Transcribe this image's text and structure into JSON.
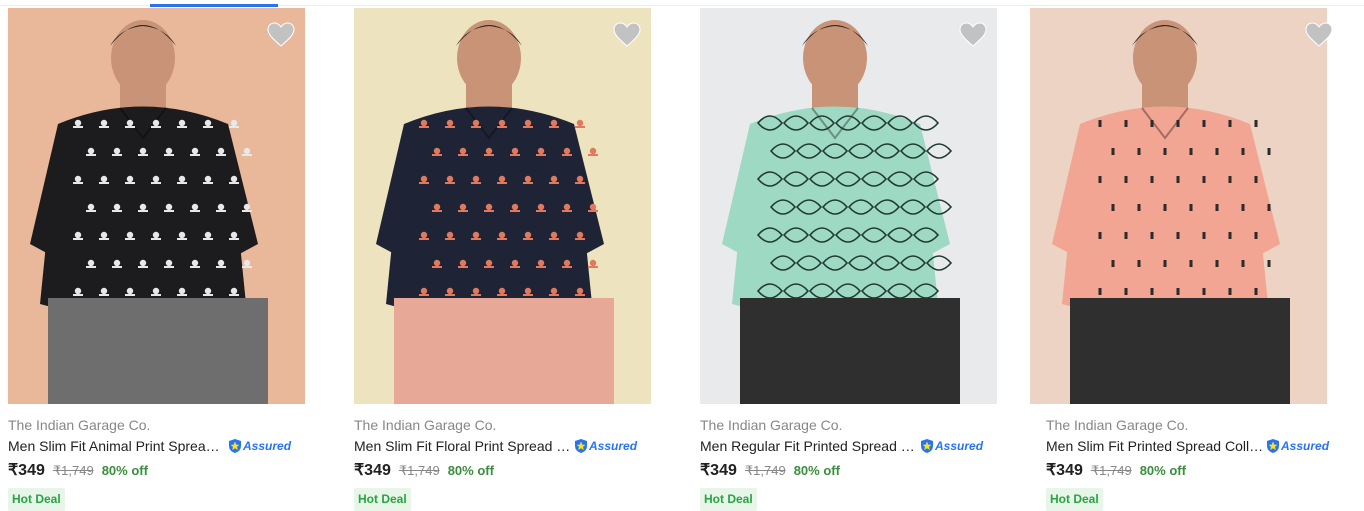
{
  "products": [
    {
      "brand": "The Indian Garage Co.",
      "title": "Men Slim Fit Animal Print Spread Collar Casual Shirt",
      "assured_label": "Assured",
      "price": "₹349",
      "mrp": "₹1,749",
      "discount": "80% off",
      "badge": "Hot Deal",
      "bg_color": "#e9b89a",
      "shirt_color": "#1c1c1f",
      "pattern_color": "#e8e8e8"
    },
    {
      "brand": "The Indian Garage Co.",
      "title": "Men Slim Fit Floral Print Spread Collar Casual Shirt",
      "assured_label": "Assured",
      "price": "₹349",
      "mrp": "₹1,749",
      "discount": "80% off",
      "badge": "Hot Deal",
      "bg_color": "#ede3bf",
      "shirt_color": "#1e2436",
      "pattern_color": "#e07a5f"
    },
    {
      "brand": "The Indian Garage Co.",
      "title": "Men Regular Fit Printed Spread Collar Casual Shirt",
      "assured_label": "Assured",
      "price": "₹349",
      "mrp": "₹1,749",
      "discount": "80% off",
      "badge": "Hot Deal",
      "bg_color": "#e9eaec",
      "shirt_color": "#9ed9c3",
      "pattern_color": "#1f3a33"
    },
    {
      "brand": "The Indian Garage Co.",
      "title": "Men Slim Fit Printed Spread Collar Casual Shirt",
      "assured_label": "Assured",
      "price": "₹349",
      "mrp": "₹1,749",
      "discount": "80% off",
      "badge": "Hot Deal",
      "bg_color": "#ecd3c4",
      "shirt_color": "#f2a593",
      "pattern_color": "#2b2b2b"
    }
  ]
}
